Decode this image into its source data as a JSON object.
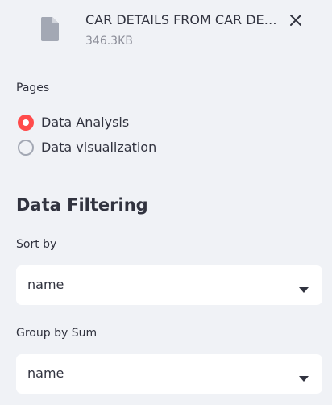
{
  "file_uploader": {
    "file_name": "CAR DETAILS FROM CAR DEKHO.csv",
    "file_size": "346.3KB",
    "icons": {
      "file": "file-icon",
      "remove": "close-icon"
    }
  },
  "pages": {
    "label": "Pages",
    "options": [
      {
        "label": "Data Analysis",
        "selected": true
      },
      {
        "label": "Data visualization",
        "selected": false
      }
    ],
    "accent_color": "#ff4b4b"
  },
  "data_filtering": {
    "heading": "Data Filtering",
    "sort_by": {
      "label": "Sort by",
      "value": "name"
    },
    "group_by_sum": {
      "label": "Group by Sum",
      "value": "name"
    }
  },
  "theme": {
    "sidebar_background": "#f0f2f6",
    "text_color": "#31333f",
    "muted_text_color": "#8b8d98"
  }
}
